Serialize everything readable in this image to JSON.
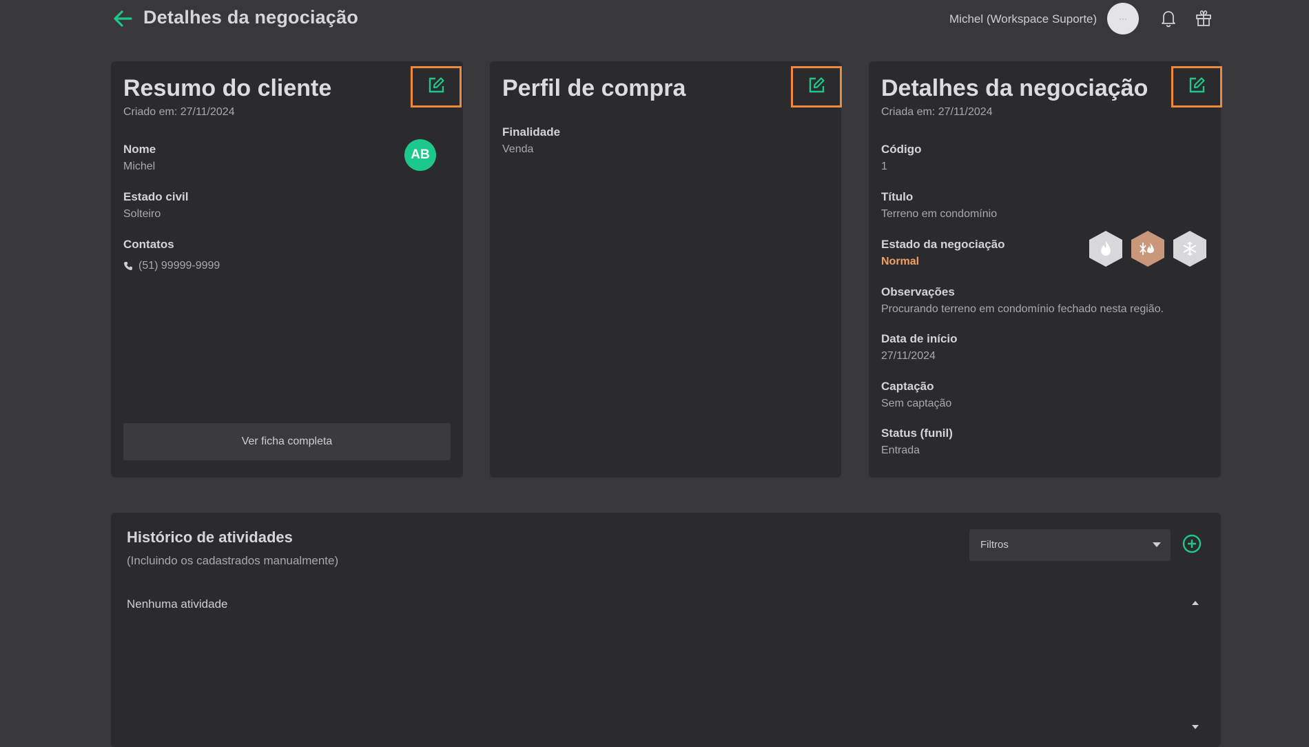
{
  "header": {
    "title": "Detalhes da negociação",
    "user_name": "Michel (Workspace Suporte)",
    "avatar_text": "···",
    "icons": [
      "back-arrow-icon",
      "bell-icon",
      "gift-icon"
    ]
  },
  "client_card": {
    "title": "Resumo do cliente",
    "created": "Criado em: 27/11/2024",
    "name_label": "Nome",
    "name_value": "Michel",
    "avatar_initials": "AB",
    "civil_label": "Estado civil",
    "civil_value": "Solteiro",
    "contacts_label": "Contatos",
    "phone": "(51) 99999-9999",
    "full_button": "Ver ficha completa"
  },
  "profile_card": {
    "title": "Perfil de compra",
    "purpose_label": "Finalidade",
    "purpose_value": "Venda"
  },
  "deal_card": {
    "title": "Detalhes da negociação",
    "created": "Criada em: 27/11/2024",
    "code_label": "Código",
    "code_value": "1",
    "title_label": "Título",
    "title_value": "Terreno em condomínio",
    "state_label": "Estado da negociação",
    "state_value": "Normal",
    "state_icons": [
      "hot-flame-icon",
      "warm-cold-icon",
      "cold-snowflake-icon"
    ],
    "notes_label": "Observações",
    "notes_value": "Procurando terreno em condomínio fechado nesta região.",
    "start_label": "Data de início",
    "start_value": "27/11/2024",
    "capture_label": "Captação",
    "capture_value": "Sem captação",
    "status_label": "Status (funil)",
    "status_value": "Entrada"
  },
  "activity": {
    "title": "Histórico de atividades",
    "subtitle": "(Incluindo os cadastrados manualmente)",
    "filter_label": "Filtros",
    "empty_text": "Nenhuma atividade"
  },
  "colors": {
    "accent_green": "#1cc98a",
    "highlight_orange": "#ee8a3a",
    "state_orange": "#f0a060",
    "background": "#37373c",
    "card": "#2b2b2f"
  }
}
